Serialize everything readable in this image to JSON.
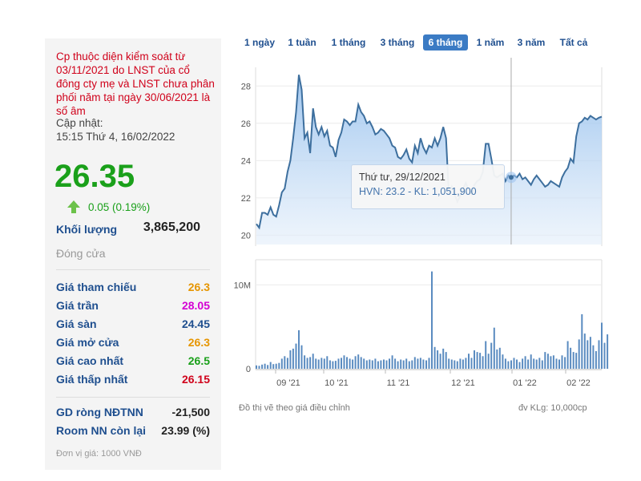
{
  "tabs": [
    "1 ngày",
    "1 tuần",
    "1 tháng",
    "3 tháng",
    "6 tháng",
    "1 năm",
    "3 năm",
    "Tất cả"
  ],
  "active_tab": "6 tháng",
  "left": {
    "notice": "Cp thuộc diện kiểm soát từ 03/11/2021 do LNST của cổ đông cty mẹ và LNST chưa phân phối năm tại ngày 30/06/2021 là số âm",
    "updated_label": "Cập nhật:",
    "updated_time": "15:15 Thứ 4, 16/02/2022",
    "price": "26.35",
    "change": "0.05 (0.19%)",
    "volume_label": "Khối lượng",
    "volume_value": "3,865,200",
    "status": "Đóng cửa",
    "prices": [
      {
        "label": "Giá tham chiếu",
        "value": "26.3",
        "color": "#e69500"
      },
      {
        "label": "Giá trần",
        "value": "28.05",
        "color": "#d400d4"
      },
      {
        "label": "Giá sàn",
        "value": "24.45",
        "color": "#1f4f8f"
      },
      {
        "label": "Giá mở cửa",
        "value": "26.3",
        "color": "#e69500"
      },
      {
        "label": "Giá cao nhất",
        "value": "26.5",
        "color": "#1aa01a"
      },
      {
        "label": "Giá thấp nhất",
        "value": "26.15",
        "color": "#d0021b"
      }
    ],
    "foreign": [
      {
        "label": "GD ròng NĐTNN",
        "value": "-21,500"
      },
      {
        "label": "Room NN còn lại",
        "value": "23.99 (%)"
      }
    ],
    "unit_note": "Đơn vị giá: 1000 VNĐ"
  },
  "tooltip": {
    "line1": "Thứ tư, 29/12/2021",
    "line2": "HVN: 23.2 - KL: 1,051,900"
  },
  "footnote": "Đồ thị vẽ theo giá điều chỉnh",
  "vol_unit": "đv KLg: 10,000cp",
  "chart_data": {
    "type": "area",
    "series": [
      {
        "name": "HVN",
        "values": [
          20.6,
          20.4,
          21.2,
          21.2,
          21.1,
          21.5,
          21.1,
          21.0,
          21.6,
          22.3,
          22.5,
          23.4,
          24.0,
          25.2,
          26.6,
          28.6,
          27.8,
          25.2,
          25.5,
          24.4,
          26.8,
          25.8,
          25.4,
          25.8,
          25.3,
          25.6,
          24.8,
          24.7,
          24.2,
          25.1,
          25.5,
          26.2,
          26.1,
          25.9,
          26.1,
          26.1,
          27.0,
          26.6,
          26.4,
          26.0,
          26.1,
          25.8,
          25.4,
          25.5,
          25.7,
          25.6,
          25.4,
          25.2,
          24.8,
          24.7,
          24.2,
          24.1,
          24.3,
          24.6,
          24.1,
          23.9,
          24.8,
          24.4,
          25.2,
          24.7,
          24.4,
          24.8,
          24.7,
          25.2,
          24.8,
          25.2,
          25.8,
          25.2,
          22.2,
          22.6,
          22.2,
          21.8,
          22.1,
          22.5,
          22.8,
          22.4,
          22.2,
          22.7,
          22.9,
          23.0,
          23.4,
          24.9,
          24.9,
          24.1,
          23.2,
          23.1,
          23.2,
          23.3,
          22.9,
          23.2,
          23.1,
          23.2,
          23.1,
          23.3,
          23.0,
          23.1,
          22.9,
          22.7,
          23.0,
          23.2,
          23.0,
          22.8,
          22.6,
          22.7,
          22.9,
          22.8,
          22.7,
          22.6,
          23.1,
          23.4,
          23.6,
          24.1,
          23.9,
          25.3,
          26.0,
          26.1,
          26.3,
          26.2,
          26.4,
          26.3,
          26.2,
          26.3,
          26.35
        ]
      },
      {
        "name": "KL",
        "values": [
          40,
          35,
          50,
          60,
          45,
          80,
          55,
          60,
          70,
          120,
          150,
          130,
          220,
          240,
          300,
          460,
          280,
          160,
          130,
          140,
          180,
          120,
          110,
          130,
          120,
          150,
          100,
          90,
          95,
          120,
          130,
          160,
          140,
          120,
          110,
          150,
          170,
          140,
          120,
          100,
          110,
          100,
          120,
          90,
          100,
          110,
          100,
          120,
          160,
          120,
          90,
          110,
          100,
          120,
          90,
          100,
          140,
          120,
          130,
          110,
          100,
          130,
          1160,
          260,
          220,
          180,
          240,
          200,
          120,
          110,
          100,
          90,
          120,
          110,
          130,
          180,
          130,
          220,
          200,
          190,
          150,
          330,
          180,
          310,
          490,
          230,
          250,
          170,
          120,
          90,
          100,
          130,
          110,
          80,
          120,
          150,
          110,
          170,
          120,
          110,
          130,
          100,
          200,
          180,
          150,
          160,
          120,
          110,
          160,
          140,
          330,
          250,
          200,
          190,
          350,
          650,
          420,
          340,
          380,
          280,
          210,
          340,
          550,
          310,
          410
        ]
      }
    ],
    "ylim_price": [
      19.5,
      29
    ],
    "ylim_volume": [
      0,
      13000000
    ],
    "price_ticks": [
      20,
      22,
      24,
      26,
      28
    ],
    "volume_ticks": [
      {
        "value": 0,
        "label": "0"
      },
      {
        "value": 10000000,
        "label": "10M"
      }
    ],
    "x_ticks": [
      "09 '21",
      "10 '21",
      "11 '21",
      "12 '21",
      "01 '22",
      "02 '22"
    ],
    "hover_index": 90
  }
}
